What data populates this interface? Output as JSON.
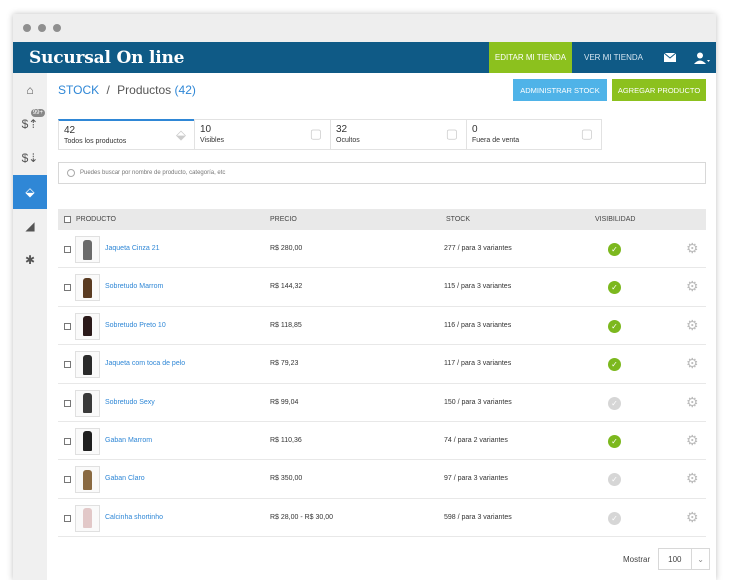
{
  "app": {
    "brand": "Sucursal On line"
  },
  "topbar": {
    "editar_label": "Editar mi tienda",
    "ver_label": "Ver mi tienda"
  },
  "sidebar": {
    "items": [
      {
        "name": "home-icon",
        "glyph": "⌂"
      },
      {
        "name": "money-up-icon",
        "glyph": "$⇡",
        "badge": "99+"
      },
      {
        "name": "money-down-icon",
        "glyph": "$⇣"
      },
      {
        "name": "tag-icon",
        "glyph": "⬙"
      },
      {
        "name": "megaphone-icon",
        "glyph": "◢"
      },
      {
        "name": "gear-icon",
        "glyph": "✱"
      }
    ]
  },
  "header": {
    "stock_label": "STOCK",
    "separator": "/",
    "products_label": "Productos",
    "products_count": "(42)"
  },
  "actions": {
    "admin_label": "Administrar stock",
    "add_label": "Agregar producto"
  },
  "tabs": [
    {
      "num": "42",
      "label": "Todos los productos"
    },
    {
      "num": "10",
      "label": "Visibles"
    },
    {
      "num": "32",
      "label": "Ocultos"
    },
    {
      "num": "0",
      "label": "Fuera de venta"
    }
  ],
  "search": {
    "placeholder": "Puedes buscar por nombre de producto, categoría, etc"
  },
  "table": {
    "headers": {
      "producto": "Producto",
      "precio": "Precio",
      "stock": "Stock",
      "visibilidad": "Visibilidad"
    },
    "rows": [
      {
        "name": "Jaqueta Cinza 21",
        "price": "R$ 280,00",
        "stock": "277 / para 3 variantes",
        "visible": true,
        "color": "#6b6b6b"
      },
      {
        "name": "Sobretudo Marrom",
        "price": "R$ 144,32",
        "stock": "115 / para 3 variantes",
        "visible": true,
        "color": "#5a3b22"
      },
      {
        "name": "Sobretudo Preto 10",
        "price": "R$ 118,85",
        "stock": "116 / para 3 variantes",
        "visible": true,
        "color": "#2b1a1a"
      },
      {
        "name": "Jaqueta com toca de pelo",
        "price": "R$ 79,23",
        "stock": "117 / para 3 variantes",
        "visible": true,
        "color": "#2a2a2a"
      },
      {
        "name": "Sobretudo Sexy",
        "price": "R$ 99,04",
        "stock": "150 / para 3 variantes",
        "visible": false,
        "color": "#3a3a3a"
      },
      {
        "name": "Gaban Marrom",
        "price": "R$ 110,36",
        "stock": "74 / para 2 variantes",
        "visible": true,
        "color": "#1f1f1f"
      },
      {
        "name": "Gaban Claro",
        "price": "R$ 350,00",
        "stock": "97 / para 3 variantes",
        "visible": false,
        "color": "#8a6a42"
      },
      {
        "name": "Calcinha shortinho",
        "price": "R$ 28,00 - R$ 30,00",
        "stock": "598 / para 3 variantes",
        "visible": false,
        "color": "#e2c8c8"
      }
    ]
  },
  "footer": {
    "mostrar_label": "Mostrar",
    "page_size": "100"
  }
}
